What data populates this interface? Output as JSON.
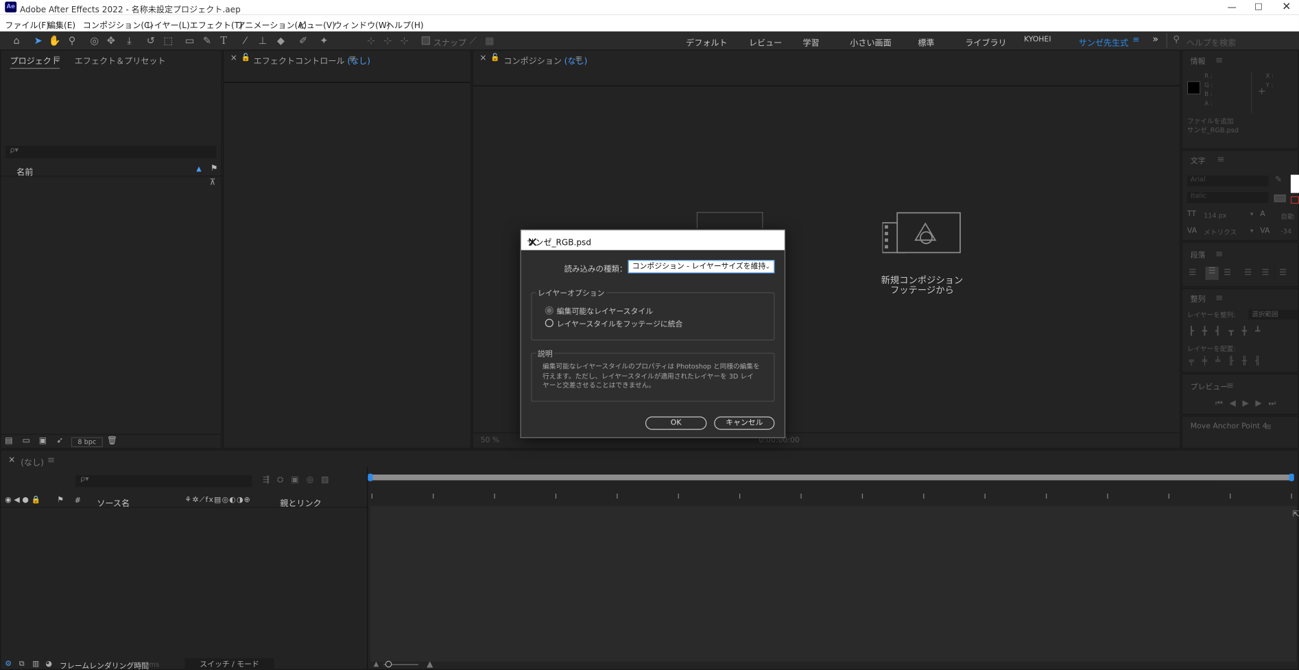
{
  "window": {
    "app_icon": "Ae",
    "title": "Adobe After Effects 2022 - 名称未設定プロジェクト.aep"
  },
  "menu": [
    "ファイル(F)",
    "編集(E)",
    "コンポジション(C)",
    "レイヤー(L)",
    "エフェクト(T)",
    "アニメーション(A)",
    "ビュー(V)",
    "ウィンドウ(W)",
    "ヘルプ(H)"
  ],
  "toolbar": {
    "snap_label": "スナップ",
    "workspaces": [
      "デフォルト",
      "レビュー",
      "学習",
      "小さい画面",
      "標準",
      "ライブラリ",
      "KYOHEI",
      "サンゼ先生式"
    ],
    "active_workspace": "サンゼ先生式",
    "search_placeholder": "ヘルプを検索",
    "accent": "#2d8ceb"
  },
  "project_panel": {
    "tab_project": "プロジェクト",
    "tab_effects": "エフェクト＆プリセット",
    "search_placeholder": "ρ▾",
    "column_name": "名前",
    "bpc": "8 bpc"
  },
  "effect_controls": {
    "label": "エフェクトコントロール",
    "value": "(なし)"
  },
  "composition": {
    "label": "コンポジション",
    "value": "(なし)",
    "new_from_footage_line1": "新規コンポジション",
    "new_from_footage_line2": "フッテージから",
    "zoom": "50 %",
    "timecode": "0:00:00:00"
  },
  "info_panel": {
    "title": "情報",
    "r": "R :",
    "g": "G :",
    "b": "B :",
    "a": "A :",
    "x": "X :",
    "y": "Y :",
    "add_file": "ファイルを追加",
    "file": "サンゼ_RGB.psd"
  },
  "character_panel": {
    "title": "文字",
    "font": "Arial",
    "style": "Italic",
    "size": "114 px",
    "leading": "自動",
    "kerning": "メトリクス",
    "tracking": "-34"
  },
  "paragraph_panel": {
    "title": "段落"
  },
  "align_panel": {
    "title": "整列",
    "align_to_label": "レイヤーを整列:",
    "align_to_value": "選択範囲",
    "distribute_label": "レイヤーを配置:"
  },
  "preview_panel": {
    "title": "プレビュー"
  },
  "move_anchor": {
    "title": "Move Anchor Point 4"
  },
  "timeline": {
    "tab": "(なし)",
    "search_placeholder": "ρ▾",
    "col_hash": "#",
    "col_source": "ソース名",
    "col_parent": "親とリンク",
    "render_time_label": "フレームレンダリング時間",
    "render_time_value": "0ms",
    "switch_mode": "スイッチ / モード"
  },
  "dialog": {
    "title": "サンゼ_RGB.psd",
    "import_kind_label": "読み込みの種類：",
    "import_kind_value": "コンポジション - レイヤーサイズを維持",
    "layer_options_label": "レイヤーオプション",
    "option_editable": "編集可能なレイヤースタイル",
    "option_merge": "レイヤースタイルをフッテージに統合",
    "option_editable_selected": true,
    "description_label": "説明",
    "description_text": "編集可能なレイヤースタイルのプロパティは Photoshop と同様の編集を行えます。ただし、レイヤースタイルが適用されたレイヤーを 3D レイヤーと交差させることはできません。",
    "ok": "OK",
    "cancel": "キャンセル"
  }
}
